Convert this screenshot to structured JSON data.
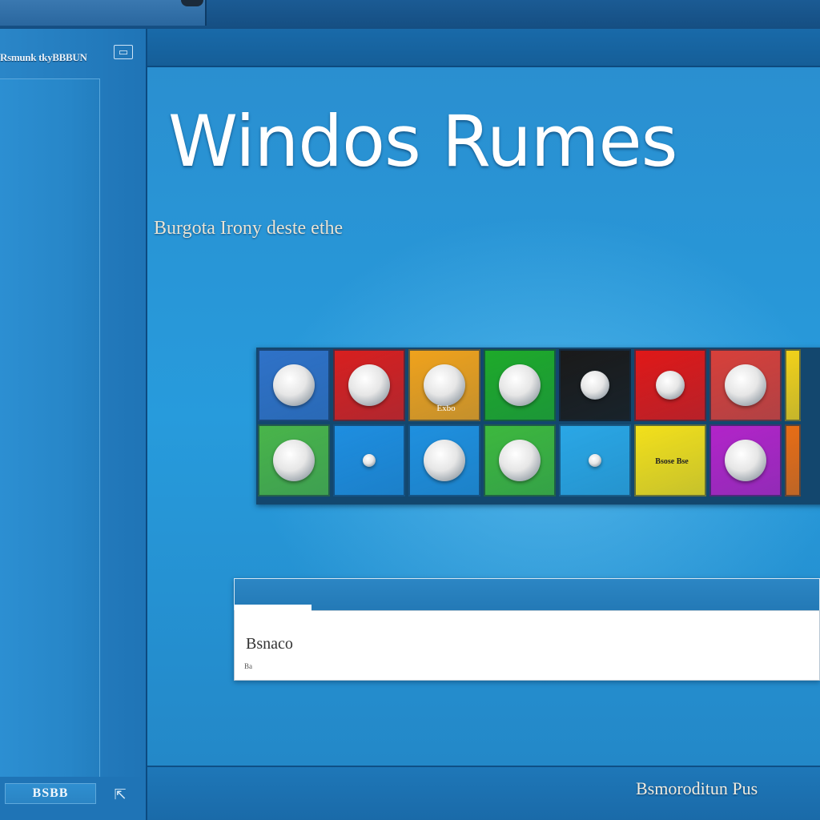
{
  "left_panel": {
    "title": "Rsmunk tkyBBBUN",
    "header_icon": "window-icon",
    "footer_label": "BSBB",
    "footer_icon": "cursor-icon"
  },
  "main": {
    "title": "Windos Rumes",
    "subtitle": "Burgota Irony deste ethe",
    "search": {
      "value": "Bsnaco",
      "hint": "Ba"
    },
    "footer_text": "Bsmoroditun Pus"
  },
  "tiles": [
    {
      "color": "#2f72c8",
      "icon": "disc-icon",
      "caption": ""
    },
    {
      "color": "#d81f1f",
      "icon": "disc-icon",
      "caption": ""
    },
    {
      "color": "#f0a21c",
      "icon": "disc-icon",
      "caption": "Exbo"
    },
    {
      "color": "#1eaa2a",
      "icon": "disc-icon",
      "caption": ""
    },
    {
      "color": "#1a1a1a",
      "icon": "gear-icon",
      "caption": ""
    },
    {
      "color": "#e01818",
      "icon": "apple-icon",
      "caption": ""
    },
    {
      "color": "#d8403a",
      "icon": "target-icon",
      "caption": ""
    },
    {
      "color": "#f2d11a",
      "icon": "partial-icon",
      "caption": ""
    },
    {
      "color": "#49b54a",
      "icon": "coin-icon",
      "caption": ""
    },
    {
      "color": "#1e8ee0",
      "icon": "dot-icon",
      "caption": ""
    },
    {
      "color": "#1f90df",
      "icon": "network-icon",
      "caption": ""
    },
    {
      "color": "#3db83e",
      "icon": "badge-icon",
      "caption": ""
    },
    {
      "color": "#2aa7e6",
      "icon": "drop-icon",
      "caption": ""
    },
    {
      "color": "#f3e01b",
      "icon": "text-icon",
      "caption": "Bsose Bse"
    },
    {
      "color": "#b224c9",
      "icon": "ring-icon",
      "caption": ""
    },
    {
      "color": "#e86d15",
      "icon": "partial-icon",
      "caption": ""
    }
  ]
}
